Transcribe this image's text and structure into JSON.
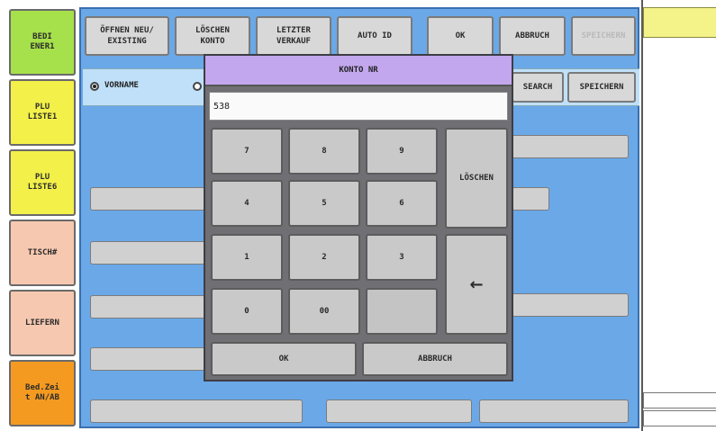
{
  "left_nav": [
    {
      "label": "BEDI\nENER1"
    },
    {
      "label": "PLU\nLISTE1"
    },
    {
      "label": "PLU\nLISTE6"
    },
    {
      "label": "TISCH#"
    },
    {
      "label": "LIEFERN"
    },
    {
      "label": "Bed.Zei\nt AN/AB"
    }
  ],
  "toolbar": {
    "open_label": "ÖFFNEN NEU/\nEXISTING",
    "delete_label": "LÖSCHEN\nKONTO",
    "last_sale_label": "LETZTER\nVERKAUF",
    "auto_id_label": "AUTO ID",
    "ok_label": "OK",
    "cancel_label": "ABBRUCH",
    "disabled_label": "SPEICHERN"
  },
  "search_row": {
    "radio_1_label": "VORNAME",
    "search_label": "SEARCH",
    "save_label": "SPEICHERN"
  },
  "modal": {
    "title": "KONTO NR",
    "input_value": "538",
    "keys": {
      "k7": "7",
      "k8": "8",
      "k9": "9",
      "k4": "4",
      "k5": "5",
      "k6": "6",
      "k1": "1",
      "k2": "2",
      "k3": "3",
      "k0": "0",
      "k00": "00"
    },
    "clear_label": "LÖSCHEN",
    "backspace_symbol": "←",
    "ok_label": "OK",
    "cancel_label": "ABBRUCH"
  }
}
